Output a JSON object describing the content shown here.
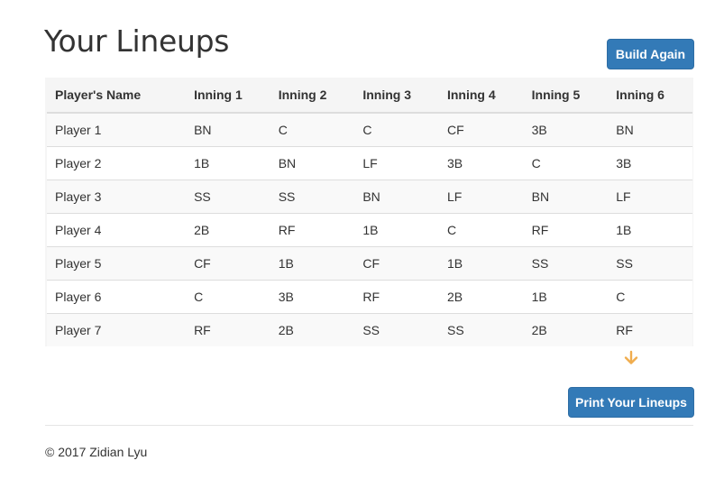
{
  "page": {
    "title": "Your Lineups",
    "build_again_label": "Build Again",
    "print_label": "Print Your Lineups",
    "footer": "© 2017 Zidian Lyu"
  },
  "table": {
    "headers": [
      "Player's Name",
      "Inning 1",
      "Inning 2",
      "Inning 3",
      "Inning 4",
      "Inning 5",
      "Inning 6"
    ],
    "rows": [
      [
        "Player 1",
        "BN",
        "C",
        "C",
        "CF",
        "3B",
        "BN"
      ],
      [
        "Player 2",
        "1B",
        "BN",
        "LF",
        "3B",
        "C",
        "3B"
      ],
      [
        "Player 3",
        "SS",
        "SS",
        "BN",
        "LF",
        "BN",
        "LF"
      ],
      [
        "Player 4",
        "2B",
        "RF",
        "1B",
        "C",
        "RF",
        "1B"
      ],
      [
        "Player 5",
        "CF",
        "1B",
        "CF",
        "1B",
        "SS",
        "SS"
      ],
      [
        "Player 6",
        "C",
        "3B",
        "RF",
        "2B",
        "1B",
        "C"
      ],
      [
        "Player 7",
        "RF",
        "2B",
        "SS",
        "SS",
        "2B",
        "RF"
      ]
    ]
  },
  "icons": {
    "scroll_hint": "arrow-down-icon"
  },
  "colors": {
    "primary": "#337ab7",
    "arrow": "#f0ad4e"
  }
}
